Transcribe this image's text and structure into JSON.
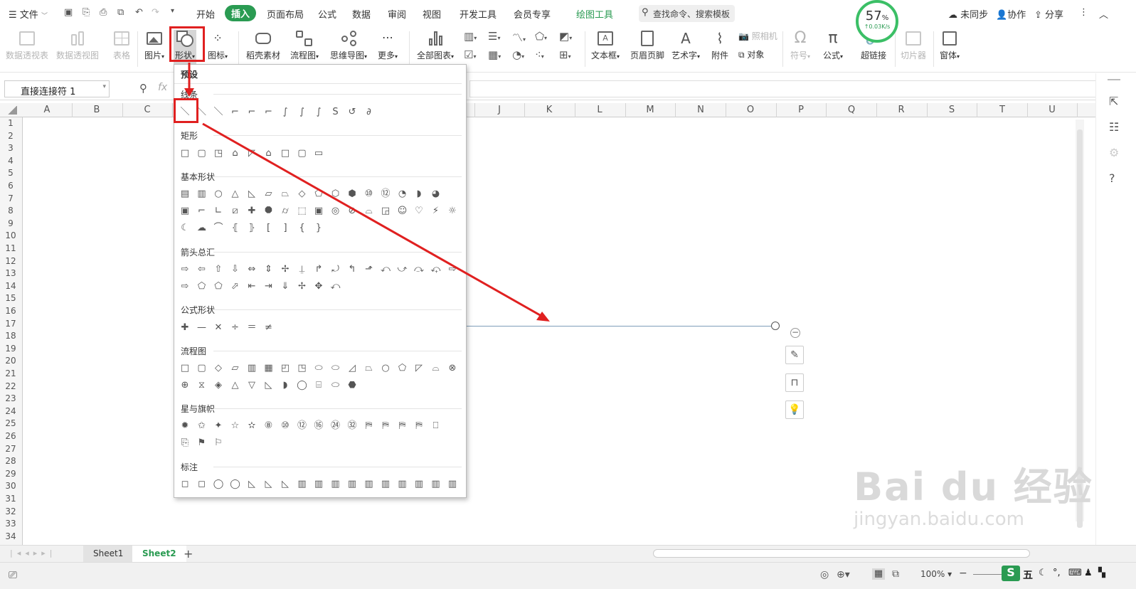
{
  "menubar": {
    "file": "文件",
    "tabs": [
      "开始",
      "插入",
      "页面布局",
      "公式",
      "数据",
      "审阅",
      "视图",
      "开发工具",
      "会员专享",
      "绘图工具"
    ],
    "search": "查找命令、搜索模板",
    "speed_pct": "57",
    "speed_unit": "%",
    "speed_rate": "0.03K/s",
    "sync": "未同步",
    "collab": "协作",
    "share": "分享"
  },
  "ribbon": {
    "pivot_table": "数据透视表",
    "pivot_chart": "数据透视图",
    "table": "表格",
    "picture": "图片",
    "shape": "形状",
    "icon": "图标",
    "material": "稻壳素材",
    "flowchart": "流程图",
    "mindmap": "思维导图",
    "more": "更多",
    "all_charts": "全部图表",
    "textbox": "文本框",
    "header_footer": "页眉页脚",
    "wordart": "艺术字",
    "attachment": "附件",
    "camera": "照相机",
    "object": "对象",
    "symbol": "符号",
    "formula": "公式",
    "hyperlink": "超链接",
    "slicer": "切片器",
    "window": "窗体"
  },
  "formula_bar": {
    "name_box": "直接连接符 1",
    "fx": "fx"
  },
  "columns": [
    "A",
    "B",
    "C",
    "J",
    "K",
    "L",
    "M",
    "N",
    "O",
    "P",
    "Q",
    "R",
    "S",
    "T",
    "U"
  ],
  "rows": [
    "1",
    "2",
    "3",
    "4",
    "5",
    "6",
    "7",
    "8",
    "9",
    "10",
    "11",
    "12",
    "13",
    "14",
    "15",
    "16",
    "17",
    "18",
    "19",
    "20",
    "21",
    "22",
    "23",
    "24",
    "25",
    "26",
    "27",
    "28",
    "29",
    "30",
    "31",
    "32",
    "33",
    "34"
  ],
  "dropdown": {
    "preset": "预设",
    "sections": [
      "线条",
      "矩形",
      "基本形状",
      "箭头总汇",
      "公式形状",
      "流程图",
      "星与旗帜",
      "标注"
    ]
  },
  "sheets": [
    "Sheet1",
    "Sheet2"
  ],
  "status": {
    "zoom": "100%",
    "ime": "五"
  },
  "watermark": {
    "brand": "Bai du 经验",
    "url": "jingyan.baidu.com"
  },
  "colors": {
    "accent": "#2a9b52",
    "annotation": "#e02020"
  }
}
